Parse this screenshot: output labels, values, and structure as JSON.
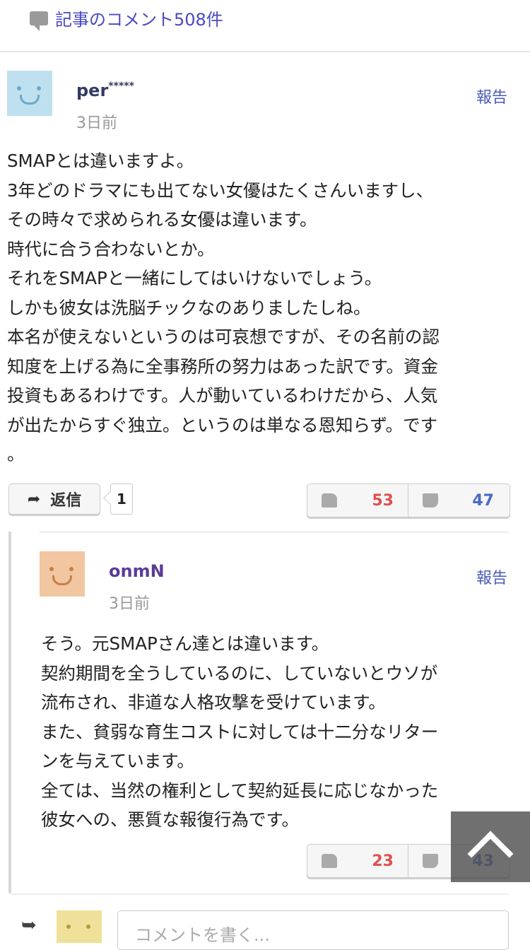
{
  "header": {
    "comments_link": "記事のコメント508件"
  },
  "comments": [
    {
      "username": "per",
      "username_mask": "*****",
      "time": "3日前",
      "report": "報告",
      "body": "SMAPとは違いますよ。\n3年どのドラマにも出てない女優はたくさんいますし、\nその時々で求められる女優は違います。\n時代に合う合わないとか。\nそれをSMAPと一緒にしてはいけないでしょう。\nしかも彼女は洗脳チックなのありましたしね。\n本名が使えないというのは可哀想ですが、その名前の認\n知度を上げる為に全事務所の努力はあった訳です。資金\n投資もあるわけです。人が動いているわけだから、人気\nが出たからすぐ独立。というのは単なる恩知らず。です\n。",
      "reply_label": "返信",
      "reply_count": "1",
      "likes": "53",
      "dislikes": "47"
    },
    {
      "username": "onmN",
      "time": "3日前",
      "report": "報告",
      "body": "そう。元SMAPさん達とは違います。\n契約期間を全うしているのに、していないとウソが\n流布され、非道な人格攻撃を受けています。\nまた、貧弱な育生コストに対しては十二分なリター\nンを与えています。\n全ては、当然の権利として契約延長に応じなかった\n彼女への、悪質な報復行為です。",
      "likes": "23",
      "dislikes": "43"
    }
  ],
  "composer": {
    "placeholder": "コメントを書く..."
  },
  "colors": {
    "like": "#e05050",
    "dislike": "#4a6ac8",
    "link": "#4a4ac0"
  }
}
